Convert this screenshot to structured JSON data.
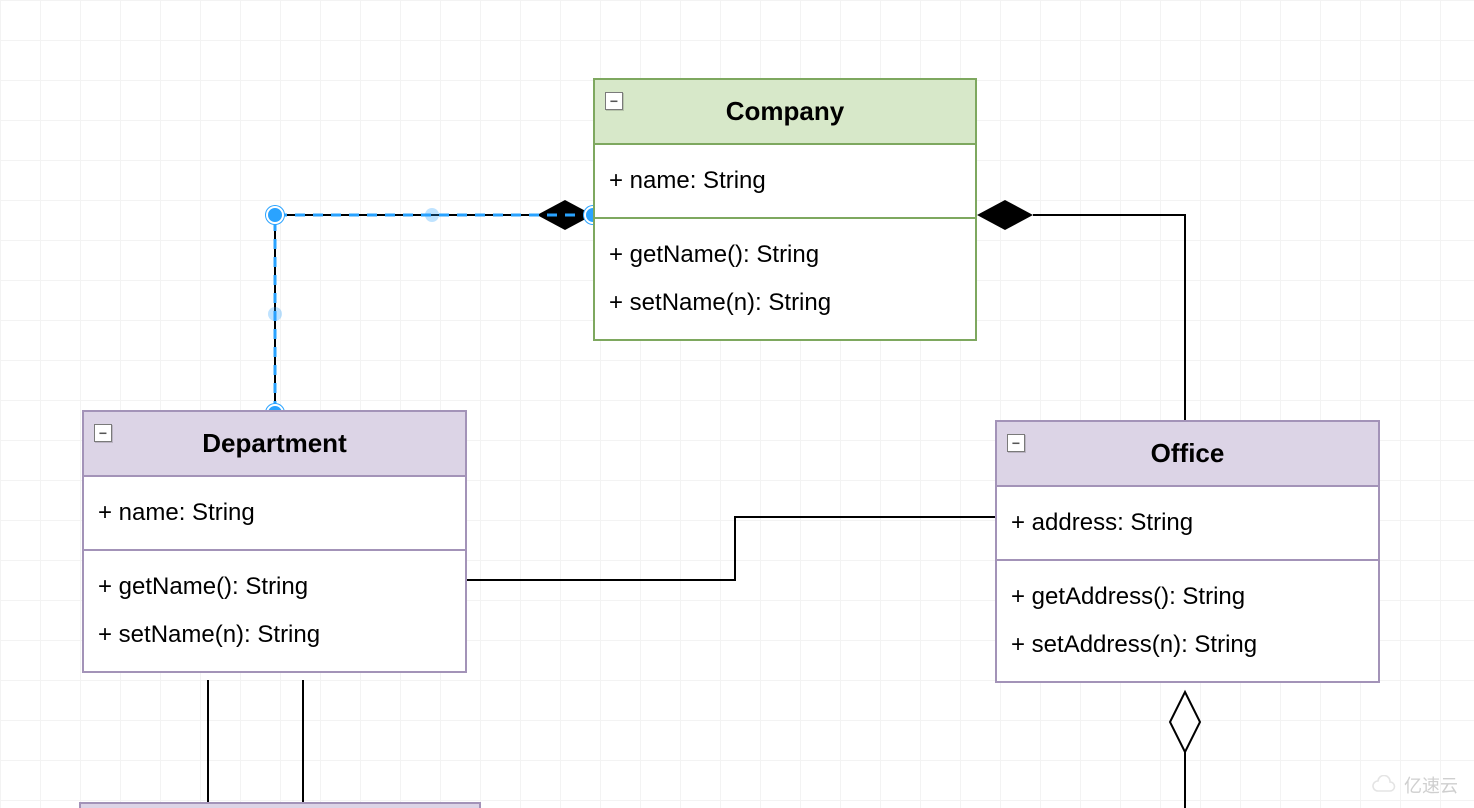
{
  "classes": {
    "company": {
      "name": "Company",
      "attributes": [
        "+ name: String"
      ],
      "methods": [
        "+ getName(): String",
        "+ setName(n): String"
      ],
      "collapse_symbol": "−"
    },
    "department": {
      "name": "Department",
      "attributes": [
        "+ name: String"
      ],
      "methods": [
        "+ getName(): String",
        "+ setName(n): String"
      ],
      "collapse_symbol": "−"
    },
    "office": {
      "name": "Office",
      "attributes": [
        "+ address: String"
      ],
      "methods": [
        "+ getAddress(): String",
        "+ setAddress(n): String"
      ],
      "collapse_symbol": "−"
    }
  },
  "connectors": [
    {
      "from": "Company",
      "to": "Department",
      "type": "composition",
      "selected": true
    },
    {
      "from": "Company",
      "to": "Office",
      "type": "composition",
      "selected": false
    },
    {
      "from": "Department",
      "to": "Office",
      "type": "association",
      "selected": false
    },
    {
      "from": "Office",
      "to": "below",
      "type": "aggregation",
      "selected": false
    },
    {
      "from": "Department",
      "to": "below-left",
      "type": "association",
      "selected": false
    },
    {
      "from": "Department",
      "to": "below-right",
      "type": "association",
      "selected": false
    }
  ],
  "watermark": "亿速云"
}
